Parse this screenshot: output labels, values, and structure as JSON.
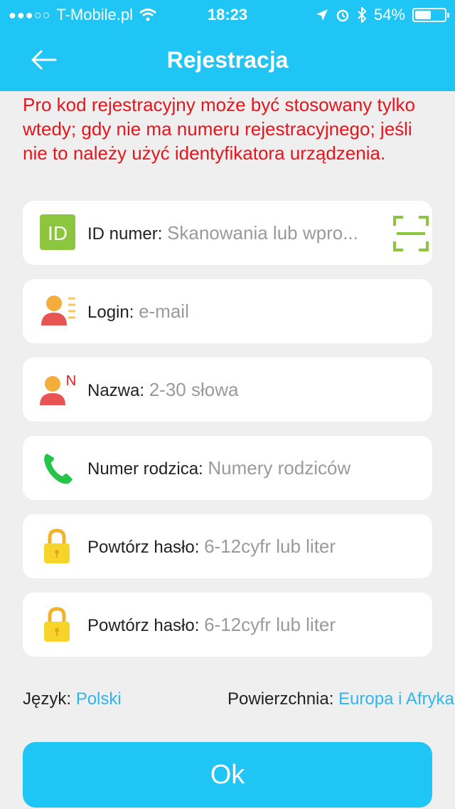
{
  "status_bar": {
    "carrier": "T-Mobile.pl",
    "time": "18:23",
    "battery_percent": "54%",
    "battery_level": 0.54,
    "icons": [
      "signal-dots-icon",
      "wifi-icon",
      "location-arrow-icon",
      "alarm-icon",
      "bluetooth-icon",
      "battery-icon"
    ]
  },
  "nav": {
    "title": "Rejestracja",
    "back_icon": "back-arrow-icon"
  },
  "notice": "Pro kod rejestracyjny może być stosowany tylko wtedy; gdy nie ma numeru rejestracyjnego; jeśli nie to należy użyć identyfikatora urządzenia.",
  "fields": [
    {
      "icon": "id-icon",
      "icon_text": "ID",
      "label": "ID numer:",
      "placeholder": "Skanowania lub wpro..."
    },
    {
      "icon": "user-list-icon",
      "label": "Login:",
      "placeholder": "e-mail"
    },
    {
      "icon": "user-name-icon",
      "icon_text": "N",
      "label": "Nazwa:",
      "placeholder": "2-30 słowa"
    },
    {
      "icon": "phone-icon",
      "label": "Numer rodzica:",
      "placeholder": "Numery rodziców"
    },
    {
      "icon": "lock-icon",
      "label": "Powtórz hasło:",
      "placeholder": "6-12cyfr lub liter"
    },
    {
      "icon": "lock-icon",
      "label": "Powtórz hasło:",
      "placeholder": "6-12cyfr lub liter"
    }
  ],
  "scan_icon": "scan-qr-icon",
  "settings": {
    "language_label": "Język:",
    "language_value": "Polski",
    "region_label": "Powierzchnia:",
    "region_value": "Europa i Afryka"
  },
  "ok_label": "Ok",
  "colors": {
    "accent": "#1fc6f5",
    "warning": "#e8141c",
    "link": "#2fb6ee",
    "id_green": "#8cc63f"
  }
}
